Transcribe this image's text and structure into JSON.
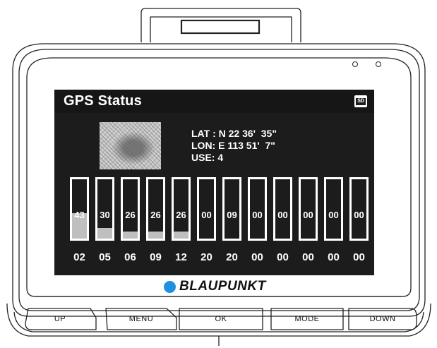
{
  "screen": {
    "title": "GPS Status",
    "sd_icon": "SD",
    "coordinates": {
      "lat": "LAT : N 22 36'  35\"",
      "lon": "LON: E 113 51'  7\"",
      "use": "USE: 4"
    },
    "satellites": [
      {
        "id": "02",
        "signal": "43",
        "level": 0.43
      },
      {
        "id": "05",
        "signal": "30",
        "level": 0.18
      },
      {
        "id": "06",
        "signal": "26",
        "level": 0.12
      },
      {
        "id": "09",
        "signal": "26",
        "level": 0.12
      },
      {
        "id": "12",
        "signal": "26",
        "level": 0.12
      },
      {
        "id": "20",
        "signal": "00",
        "level": 0
      },
      {
        "id": "20",
        "signal": "09",
        "level": 0
      },
      {
        "id": "00",
        "signal": "00",
        "level": 0
      },
      {
        "id": "00",
        "signal": "00",
        "level": 0
      },
      {
        "id": "00",
        "signal": "00",
        "level": 0
      },
      {
        "id": "00",
        "signal": "00",
        "level": 0
      },
      {
        "id": "00",
        "signal": "00",
        "level": 0
      }
    ]
  },
  "brand": {
    "name": "BLAUPUNKT",
    "dot_color": "#1f8fe0"
  },
  "buttons": {
    "up": "UP",
    "menu": "MENU",
    "ok": "OK",
    "mode": "MODE",
    "down": "DOWN"
  },
  "icons": {
    "sd_card": "sd-card-icon",
    "map": "satellite-map-icon",
    "led": "status-led-icon"
  }
}
